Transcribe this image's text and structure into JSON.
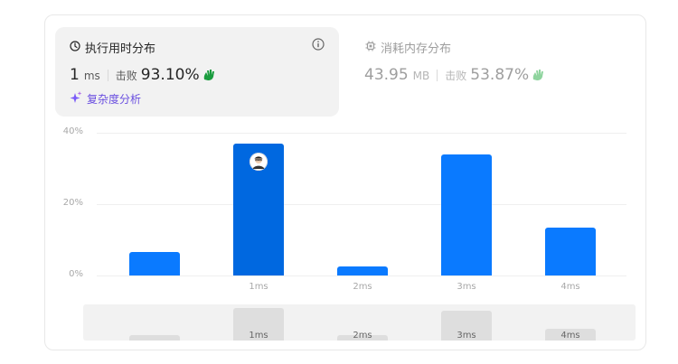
{
  "runtime_tab": {
    "title": "执行用时分布",
    "value": "1",
    "unit": "ms",
    "beat_label": "击败",
    "beat_value": "93.10%"
  },
  "memory_tab": {
    "title": "消耗内存分布",
    "value": "43.95",
    "unit": "MB",
    "beat_label": "击败",
    "beat_value": "53.87%"
  },
  "complexity_link": {
    "label": "复杂度分析"
  },
  "icons": {
    "runtime": "clock-icon",
    "memory": "chip-icon",
    "info": "info-icon",
    "sparkle": "sparkle-icon",
    "beat": "clapping-hands-icon",
    "avatar": "user-avatar"
  },
  "colors": {
    "bar": "#0a7aff",
    "bar_highlight": "#0068e0",
    "beat_runtime": "#1a9c3e",
    "beat_memory": "#8fd49e",
    "complexity": "#6a4fe0",
    "active_text": "#262626",
    "muted_text": "#9e9e9e"
  },
  "chart_data": {
    "type": "bar",
    "categories": [
      "",
      "1ms",
      "2ms",
      "3ms",
      "4ms"
    ],
    "values": [
      6.5,
      37,
      2.5,
      34,
      13.5
    ],
    "y_unit": "%",
    "ylim": [
      0,
      40
    ],
    "yticks": [
      "0%",
      "20%",
      "40%"
    ],
    "highlight_category": "1ms",
    "grid": true
  },
  "brush": {
    "labels": [
      "",
      "1ms",
      "2ms",
      "3ms",
      "4ms"
    ]
  }
}
